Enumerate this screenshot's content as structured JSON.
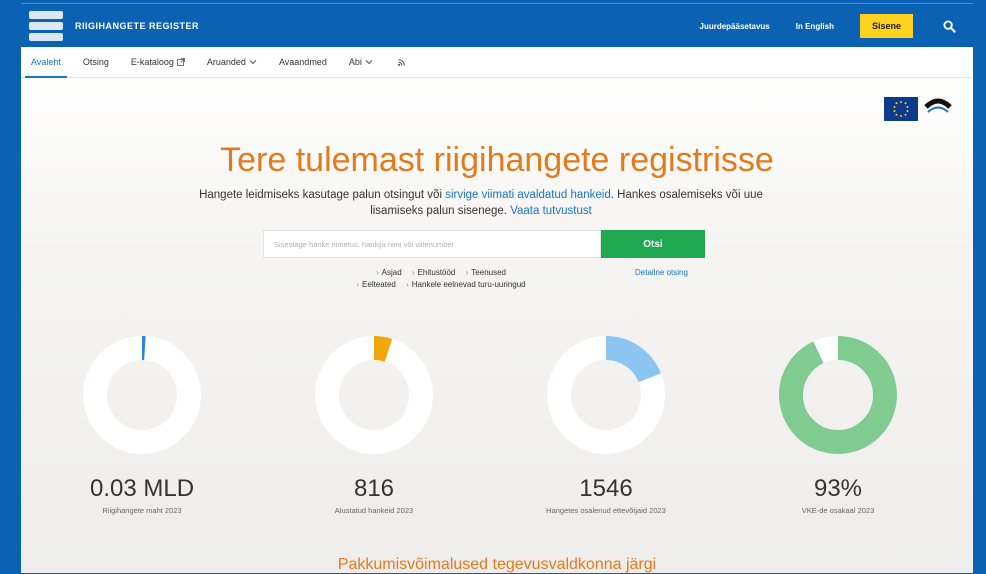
{
  "header": {
    "brand": "Riigihangete Register",
    "links": [
      "Juurdepääsetavus",
      "In English"
    ],
    "login_label": "Sisene"
  },
  "nav": {
    "items": [
      {
        "label": "Avaleht",
        "active": true
      },
      {
        "label": "Otsing"
      },
      {
        "label": "E-kataloog",
        "icon": "external-link-icon"
      },
      {
        "label": "Aruanded",
        "icon": "chevron-down-icon"
      },
      {
        "label": "Avaandmed"
      },
      {
        "label": "Abi",
        "icon": "chevron-down-icon"
      },
      {
        "label": "",
        "icon": "rss-icon"
      }
    ]
  },
  "hero": {
    "title": "Tere tulemast riigihangete registrisse",
    "text_1": "Hangete leidmiseks kasutage palun otsingut või ",
    "link_1": "sirvige viimati avaldatud hankeid",
    "text_2": ". Hankes osalemiseks või uue lisamiseks palun sisenege. ",
    "link_2": "Vaata tutvustust"
  },
  "search": {
    "placeholder": "Sisestage hanke nimetus, hankija nimi või viitenumber",
    "button_label": "Otsi",
    "detail_link": "Detailne otsing",
    "quick_links": [
      "Asjad",
      "Ehitustööd",
      "Teenused",
      "Eelteated",
      "Hankele eelnevad turu-uuringud"
    ]
  },
  "stats": [
    {
      "value": "0.03 MLD",
      "label": "Riigihangete maht 2023",
      "fraction": 0.01,
      "color": "#2b86d4"
    },
    {
      "value": "816",
      "label": "Alustatud hankeid 2023",
      "fraction": 0.05,
      "color": "#f2a60c"
    },
    {
      "value": "1546",
      "label": "Hangetes osalenud ettevõtjaid 2023",
      "fraction": 0.19,
      "color": "#8cc4f2"
    },
    {
      "value": "93%",
      "label": "VKE-de osakaal 2023",
      "fraction": 0.93,
      "color": "#7fcb90"
    }
  ],
  "section": {
    "title": "Pakkumisvõimalused tegevusvaldkonna järgi"
  },
  "colors": {
    "header_blue": "#0b62b3",
    "accent_orange": "#e37b1c",
    "search_green": "#1fa84f",
    "login_yellow": "#ffd21f"
  }
}
